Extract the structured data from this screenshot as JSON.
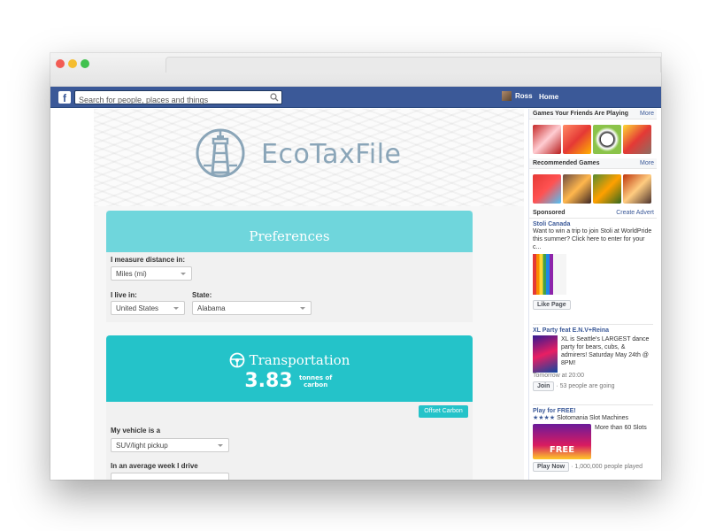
{
  "facebook": {
    "search_placeholder": "Search for people, places and things",
    "user_name": "Ross",
    "home_label": "Home"
  },
  "app": {
    "logo_text": "EcoTaxFile",
    "preferences": {
      "title": "Preferences",
      "distance_label": "I measure distance in:",
      "distance_value": "Miles (mi)",
      "live_label": "I live in:",
      "live_value": "United States",
      "state_label": "State:",
      "state_value": "Alabama"
    },
    "transportation": {
      "title": "Transportation",
      "value": "3.83",
      "unit": "tonnes of carbon",
      "offset_button": "Offset Carbon",
      "vehicle_label": "My vehicle is a",
      "vehicle_value": "SUV/light pickup",
      "week_label": "In an average week I drive"
    }
  },
  "sidebar": {
    "games_header": "Games Your Friends Are Playing",
    "more_label": "More",
    "recommended_header": "Recommended Games",
    "sponsored_label": "Sponsored",
    "create_advert": "Create Advert",
    "ads": [
      {
        "title": "Stoli Canada",
        "text": "Want to win a trip to join Stoli at WorldPride this summer? Click here to enter for your c...",
        "button": "Like Page"
      },
      {
        "title": "XL Party feat E.N.V+Reina",
        "text": "XL is Seattle's LARGEST dance party for bears, cubs, & admirers! Saturday May 24th @ 8PM!",
        "meta": "Tomorrow at 20:00",
        "button": "Join",
        "going": "· 53 people are going"
      },
      {
        "title": "Play for FREE!",
        "rating": "★★★★",
        "subtitle": "Slotomania Slot Machines",
        "text": "More than 60 Slots",
        "image_text": "FREE",
        "button": "Play Now",
        "played": "· 1,000,000 people played"
      }
    ]
  },
  "colors": {
    "facebook_blue": "#3b5998",
    "preferences_teal": "#6fd6dc",
    "transport_teal": "#24c3c9",
    "logo_gray": "#8aa5b8"
  }
}
